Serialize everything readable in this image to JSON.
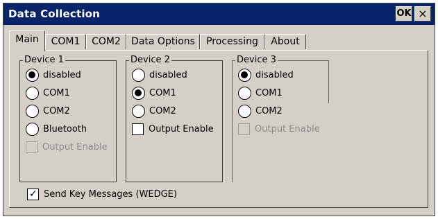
{
  "window": {
    "title": "Data Collection",
    "ok_label": "OK",
    "close_glyph": "×"
  },
  "tabs": [
    {
      "label": "Main",
      "active": true
    },
    {
      "label": "COM1",
      "active": false
    },
    {
      "label": "COM2",
      "active": false
    },
    {
      "label": "Data Options",
      "active": false
    },
    {
      "label": "Processing",
      "active": false
    },
    {
      "label": "About",
      "active": false
    }
  ],
  "devices": [
    {
      "title": "Device 1",
      "options": [
        {
          "label": "disabled",
          "selected": true
        },
        {
          "label": "COM1",
          "selected": false
        },
        {
          "label": "COM2",
          "selected": false
        },
        {
          "label": "Bluetooth",
          "selected": false
        }
      ],
      "output_enable": {
        "label": "Output Enable",
        "checked": false,
        "enabled": false
      }
    },
    {
      "title": "Device 2",
      "options": [
        {
          "label": "disabled",
          "selected": false
        },
        {
          "label": "COM1",
          "selected": true
        },
        {
          "label": "COM2",
          "selected": false
        }
      ],
      "output_enable": {
        "label": "Output Enable",
        "checked": false,
        "enabled": true
      }
    },
    {
      "title": "Device 3",
      "options": [
        {
          "label": "disabled",
          "selected": true
        },
        {
          "label": "COM1",
          "selected": false
        },
        {
          "label": "COM2",
          "selected": false
        }
      ],
      "output_enable": {
        "label": "Output Enable",
        "checked": false,
        "enabled": false
      }
    }
  ],
  "send_keys": {
    "label": "Send Key Messages (WEDGE)",
    "checked": true
  },
  "colors": {
    "title_bar": "#0a246a",
    "face": "#d4d0c8"
  }
}
